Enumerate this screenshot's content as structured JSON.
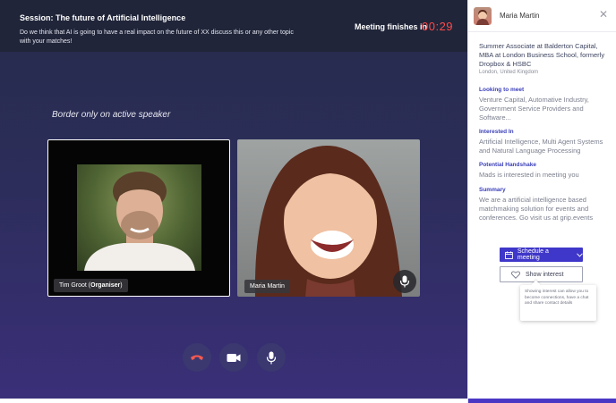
{
  "session": {
    "title": "Session: The future of Artificial Intelligence",
    "description": "Do we think that AI is going to have a real impact on the future of XX discuss this or any other topic with your matches!",
    "finish_label": "Meeting finishes in",
    "countdown": "00:29"
  },
  "stage": {
    "caption": "Border only on active speaker",
    "participants": [
      {
        "name": "Tim Groot",
        "role": "Organiser",
        "active_speaker": true
      },
      {
        "name": "Maria Martin",
        "active_speaker": false
      }
    ],
    "controls": [
      {
        "icon": "hang-up-icon",
        "color": "#ff5a4e"
      },
      {
        "icon": "video-camera-icon",
        "color": "#ffffff"
      },
      {
        "icon": "microphone-icon",
        "color": "#ffffff"
      }
    ]
  },
  "profile": {
    "name": "Maria Martin",
    "job_title": "Summer Associate at Balderton Capital, MBA at London Business School, formerly Dropbox & HSBC",
    "location": "London, United Kingdom",
    "sections": [
      {
        "heading": "Looking to meet",
        "body": "Venture Capital, Automative Industry, Government Service Providers and Software..."
      },
      {
        "heading": "Interested In",
        "body": "Artificial Intelligence, Multi Agent Systems and Natural Language Processing"
      },
      {
        "heading": "Potential Handshake",
        "body": "Mads is interested in meeting you"
      },
      {
        "heading": "Summary",
        "body": "We are a artificial intelligence based matchmaking solution for events and conferences. Go visit us at grip.events"
      }
    ],
    "schedule_label": "Schedule a meeting",
    "interest_label": "Show interest",
    "interest_tooltip": "Showing interest can allow you to become connections, have a chat and share contact details"
  },
  "colors": {
    "accent": "#3f37c9",
    "timer": "#ff4a4a",
    "section_heading": "#3a3fb8",
    "topbar": "#202539"
  }
}
